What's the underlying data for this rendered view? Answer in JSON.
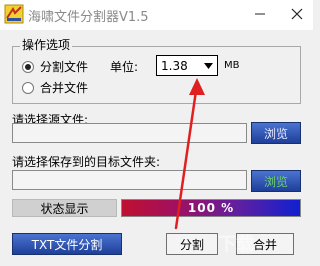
{
  "window": {
    "title": "海啸文件分割器V1.5",
    "controls": {
      "minimize": "—",
      "close": "✕"
    }
  },
  "options": {
    "group_title": "操作选项",
    "split_label": "分割文件",
    "merge_label": "合并文件",
    "selected": "split",
    "unit_label": "单位:",
    "unit_value": "1.38",
    "unit_suffix": "MB"
  },
  "source": {
    "label": "请选择源文件:",
    "value": "",
    "browse_label": "浏览"
  },
  "target": {
    "label": "请选择保存到的目标文件夹:",
    "value": "",
    "browse_label": "浏览"
  },
  "status": {
    "label": "状态显示",
    "progress_text": "100 %",
    "progress": 1.0
  },
  "actions": {
    "txt_split_label": "TXT文件分割",
    "split_label": "分割",
    "merge_label": "合并"
  },
  "watermark": "下载",
  "colors": {
    "accent_blue": "#1f3f9a",
    "browse_green": "#30a040",
    "annotation_red": "#e02020"
  }
}
